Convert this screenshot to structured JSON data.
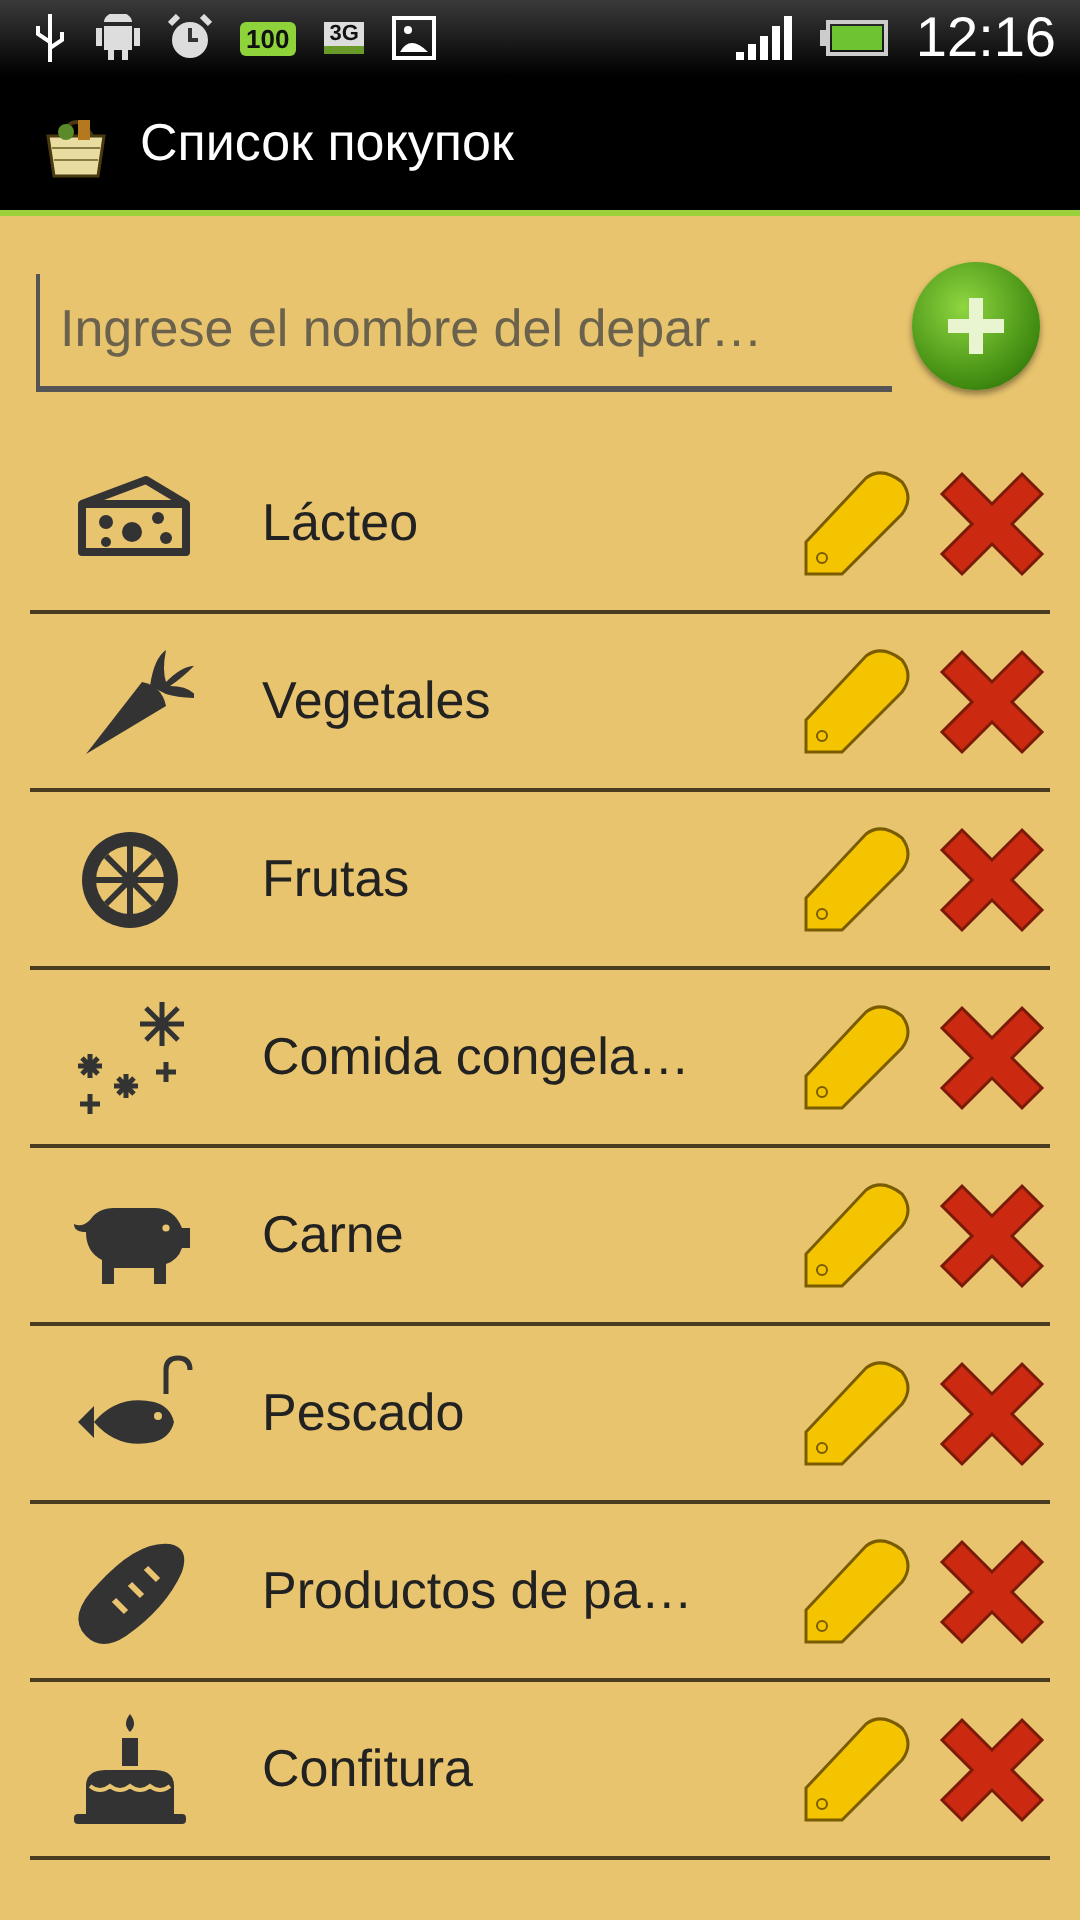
{
  "status_bar": {
    "battery_badge": "100",
    "network_badge": "3G",
    "time": "12:16"
  },
  "action_bar": {
    "title": "Список покупок"
  },
  "new_department": {
    "placeholder": "Ingrese el nombre del depar…"
  },
  "departments": [
    {
      "name": "Lácteo",
      "kind": "cheese"
    },
    {
      "name": "Vegetales",
      "kind": "carrot"
    },
    {
      "name": "Frutas",
      "kind": "lemon"
    },
    {
      "name": "Comida congela…",
      "kind": "frozen"
    },
    {
      "name": "Carne",
      "kind": "pig"
    },
    {
      "name": "Pescado",
      "kind": "fish"
    },
    {
      "name": "Productos de pa…",
      "kind": "bread"
    },
    {
      "name": "Confitura",
      "kind": "cake"
    }
  ]
}
